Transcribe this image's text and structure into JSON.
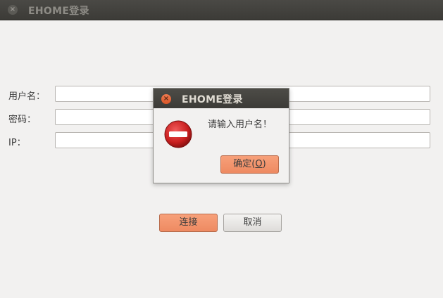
{
  "window": {
    "title": "EHOME登录"
  },
  "form": {
    "username_label": "用户名：",
    "password_label": "密码：",
    "ip_label": "IP：",
    "username_value": "",
    "password_value": "",
    "ip_value": ""
  },
  "buttons": {
    "connect_label": "连接",
    "cancel_label": "取消"
  },
  "dialog": {
    "title": "EHOME登录",
    "message": "请输入用户名！",
    "ok_label": "确定(O)",
    "ok_mnemonic": "O",
    "icon": "error-icon"
  },
  "colors": {
    "accent": "#ee8a62",
    "titlebar": "#3c3b37",
    "error_red": "#d12d2d"
  }
}
